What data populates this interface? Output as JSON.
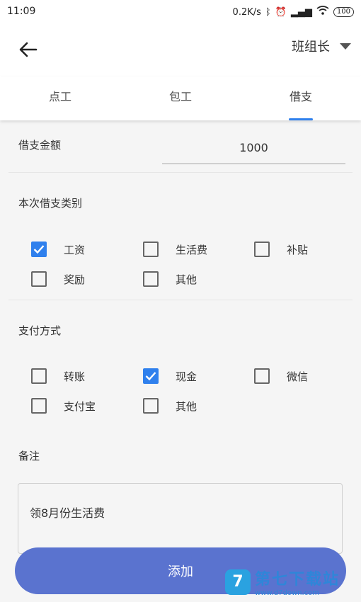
{
  "status_bar": {
    "time": "11:09",
    "speed": "0.2K/s",
    "battery": "100"
  },
  "header": {
    "role": "班组长"
  },
  "tabs": [
    {
      "label": "点工",
      "active": false
    },
    {
      "label": "包工",
      "active": false
    },
    {
      "label": "借支",
      "active": true
    }
  ],
  "form": {
    "amount_label": "借支金额",
    "amount_value": "1000",
    "category_label": "本次借支类别",
    "categories": [
      {
        "label": "工资",
        "checked": true
      },
      {
        "label": "生活费",
        "checked": false
      },
      {
        "label": "补贴",
        "checked": false
      },
      {
        "label": "奖励",
        "checked": false
      },
      {
        "label": "其他",
        "checked": false
      }
    ],
    "payment_label": "支付方式",
    "payments": [
      {
        "label": "转账",
        "checked": false
      },
      {
        "label": "现金",
        "checked": true
      },
      {
        "label": "微信",
        "checked": false
      },
      {
        "label": "支付宝",
        "checked": false
      },
      {
        "label": "其他",
        "checked": false
      }
    ],
    "remark_label": "备注",
    "remark_value": "领8月份生活费"
  },
  "actions": {
    "add_label": "添加"
  },
  "watermark": {
    "title": "第七下载站",
    "url": "www.d7down.com"
  },
  "colors": {
    "accent": "#2f80ed",
    "button": "#5a73cf"
  }
}
